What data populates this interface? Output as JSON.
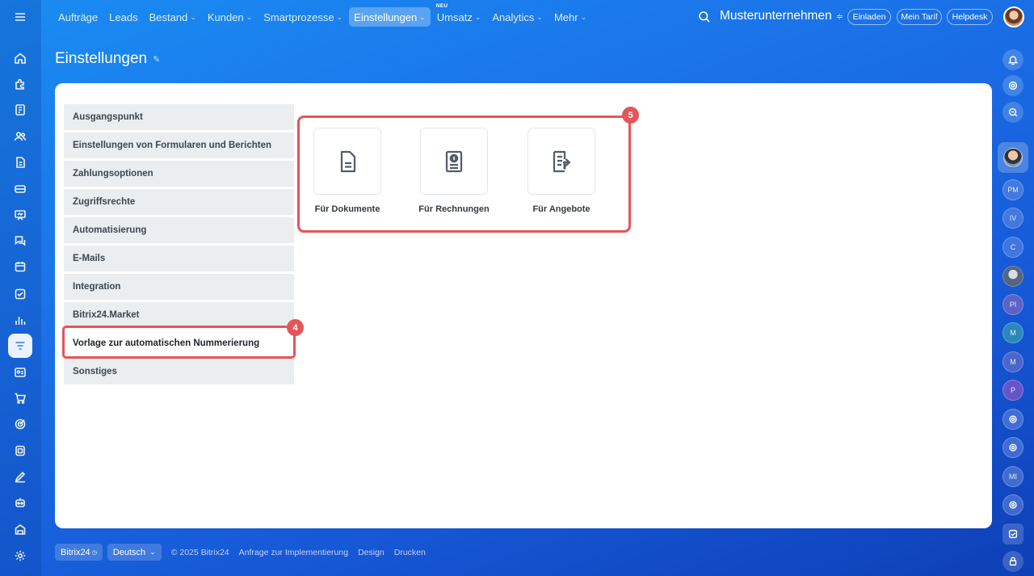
{
  "topnav": {
    "items": [
      {
        "label": "Aufträge",
        "chevron": false
      },
      {
        "label": "Leads",
        "chevron": false
      },
      {
        "label": "Bestand",
        "chevron": true
      },
      {
        "label": "Kunden",
        "chevron": true
      },
      {
        "label": "Smartprozesse",
        "chevron": true
      },
      {
        "label": "Einstellungen",
        "chevron": true,
        "active": true
      },
      {
        "label": "Umsatz",
        "chevron": true,
        "badge": "NEU"
      },
      {
        "label": "Analytics",
        "chevron": true
      },
      {
        "label": "Mehr",
        "chevron": true
      }
    ],
    "chevron_glyph": "⌄"
  },
  "header": {
    "company": "Musterunternehmen",
    "invite_label": "Einladen",
    "tariff_label": "Mein Tarif",
    "helpdesk_label": "Helpdesk"
  },
  "page": {
    "title": "Einstellungen"
  },
  "settings_menu": {
    "items": [
      "Ausgangspunkt",
      "Einstellungen von Formularen und Berichten",
      "Zahlungsoptionen",
      "Zugriffsrechte",
      "Automatisierung",
      "E-Mails",
      "Integration",
      "Bitrix24.Market",
      "Vorlage zur automatischen Nummerierung",
      "Sonstiges"
    ],
    "selected_index": 8
  },
  "annotations": {
    "menu_badge": "4",
    "tiles_badge": "5",
    "badge_color": "#e4555a"
  },
  "templates": {
    "tiles": [
      {
        "label": "Für Dokumente",
        "icon": "document-icon"
      },
      {
        "label": "Für Rechnungen",
        "icon": "invoice-icon"
      },
      {
        "label": "Für Angebote",
        "icon": "offer-icon"
      }
    ]
  },
  "right_sidebar": {
    "initials": [
      "PM",
      "IV",
      "C",
      "PI",
      "M",
      "M",
      "P",
      "MI"
    ]
  },
  "footer": {
    "brand": "Bitrix24",
    "language": "Deutsch",
    "copyright": "© 2025 Bitrix24",
    "links": [
      "Anfrage zur Implementierung",
      "Design",
      "Drucken"
    ]
  }
}
